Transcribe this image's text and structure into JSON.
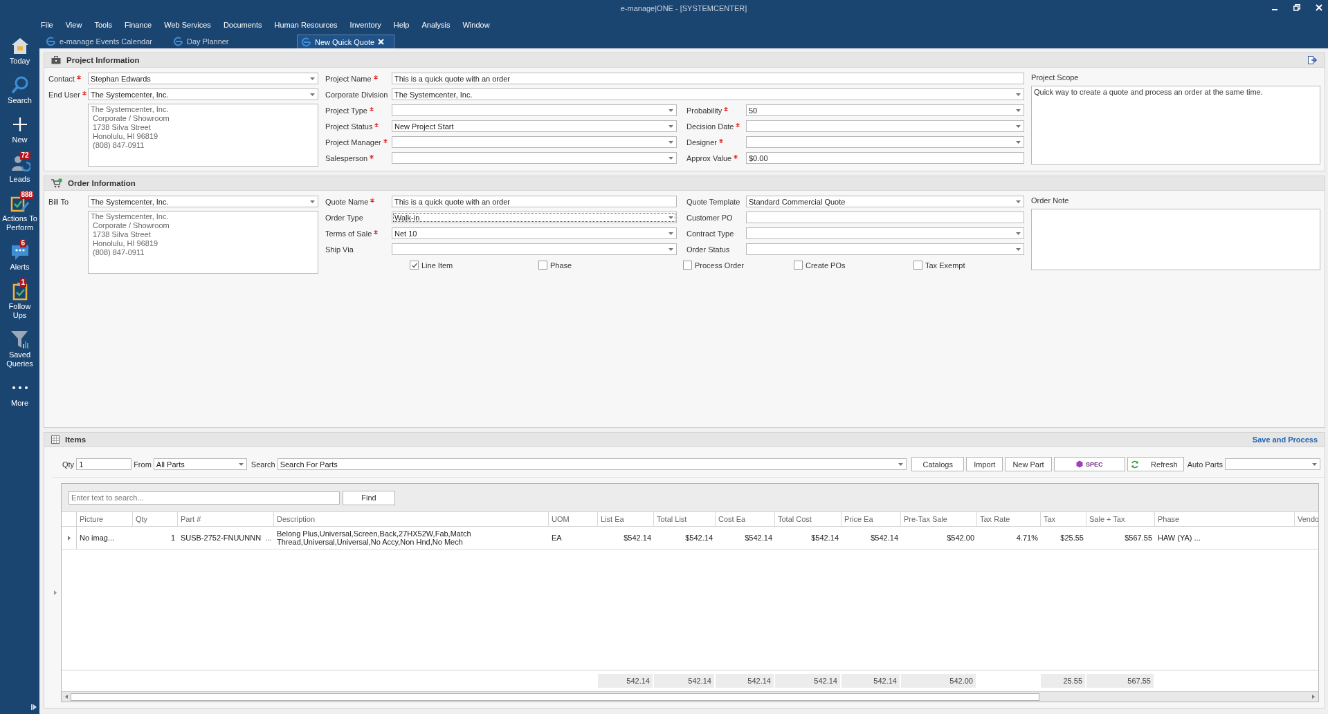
{
  "window": {
    "title": "e-manage|ONE - [SYSTEMCENTER]"
  },
  "menu": [
    "File",
    "View",
    "Tools",
    "Finance",
    "Web Services",
    "Documents",
    "Human Resources",
    "Inventory",
    "Help",
    "Analysis",
    "Window"
  ],
  "sidebar": [
    {
      "label": "Today"
    },
    {
      "label": "Search"
    },
    {
      "label": "New"
    },
    {
      "label": "Leads",
      "badge": "72"
    },
    {
      "label": "Actions To Perform",
      "badge": "888"
    },
    {
      "label": "Alerts",
      "badge": "6"
    },
    {
      "label": "Follow Ups",
      "badge": "1"
    },
    {
      "label": "Saved Queries"
    },
    {
      "label": "More"
    }
  ],
  "tabs": [
    {
      "label": "e-manage Events Calendar",
      "selected": false
    },
    {
      "label": "Day Planner",
      "selected": false
    },
    {
      "label": "New Quick Quote",
      "selected": true
    }
  ],
  "project_information": {
    "title": "Project Information",
    "contact": {
      "label": "Contact",
      "required": true,
      "value": "Stephan Edwards",
      "dropdown": true
    },
    "end_user": {
      "label": "End User",
      "required": true,
      "value": "The Systemcenter, Inc.",
      "dropdown": true
    },
    "address": [
      "The Systemcenter, Inc.",
      "Corporate / Showroom",
      "1738 Silva Street",
      "Honolulu, HI 96819",
      "(808) 847-0911"
    ],
    "wide_fields": [
      {
        "label": "Project Name",
        "required": true,
        "value": "This is a quick quote with an order",
        "dropdown": false
      },
      {
        "label": "Corporate Division",
        "required": false,
        "value": "The Systemcenter, Inc.",
        "dropdown": true
      }
    ],
    "fields": [
      {
        "label": "Project Type",
        "required": true,
        "dropdown": true
      },
      {
        "label": "Probability",
        "required": true,
        "value": "50",
        "dropdown": true
      },
      {
        "label": "Project Status",
        "required": true,
        "value": "New Project Start",
        "dropdown": true
      },
      {
        "label": "Decision Date",
        "required": true,
        "dropdown": true
      },
      {
        "label": "Project Manager",
        "required": true,
        "dropdown": true
      },
      {
        "label": "Designer",
        "required": true,
        "dropdown": true
      },
      {
        "label": "Salesperson",
        "required": true,
        "dropdown": true
      },
      {
        "label": "Approx Value",
        "required": true,
        "value": "$0.00",
        "dropdown": false
      }
    ],
    "scope": {
      "label": "Project Scope",
      "value": "Quick way to create a quote and process an order at the same time."
    }
  },
  "order_information": {
    "title": "Order Information",
    "bill_to": {
      "label": "Bill To",
      "required": false,
      "value": "The Systemcenter, Inc.",
      "dropdown": true
    },
    "address": [
      "The Systemcenter, Inc.",
      "Corporate / Showroom",
      "1738 Silva Street",
      "Honolulu, HI 96819",
      "(808) 847-0911"
    ],
    "fields": [
      {
        "label": "Quote Name",
        "required": true,
        "value": "This is a quick quote with an order",
        "dropdown": false
      },
      {
        "label": "Quote Template",
        "required": false,
        "value": "Standard Commercial Quote",
        "dropdown": true
      },
      {
        "label": "Order Type",
        "required": false,
        "value": "Walk-in",
        "dropdown": true,
        "focused": true
      },
      {
        "label": "Customer PO",
        "required": false,
        "dropdown": false
      },
      {
        "label": "Terms of Sale",
        "required": true,
        "value": "Net 10",
        "dropdown": true
      },
      {
        "label": "Contract Type",
        "required": false,
        "dropdown": true
      },
      {
        "label": "Ship Via",
        "required": false,
        "dropdown": true
      },
      {
        "label": "Order Status",
        "required": false,
        "dropdown": true
      }
    ],
    "options": [
      {
        "label": "Line Item",
        "checked": true
      },
      {
        "label": "Phase",
        "checked": false
      },
      {
        "label": "Process Order",
        "checked": false
      },
      {
        "label": "Create POs",
        "checked": false
      },
      {
        "label": "Tax Exempt",
        "checked": false
      }
    ],
    "note": {
      "label": "Order Note"
    }
  },
  "items": {
    "title": "Items",
    "save_link": "Save and Process",
    "qty": {
      "label": "Qty",
      "value": "1"
    },
    "from": {
      "label": "From",
      "value": "All Parts"
    },
    "search": {
      "label": "Search",
      "value": "Search For Parts"
    },
    "buttons": [
      {
        "label": "Catalogs",
        "kind": "plain"
      },
      {
        "label": "Import",
        "kind": "plain"
      },
      {
        "label": "New Part",
        "kind": "plain"
      },
      {
        "label": "SPEC",
        "kind": "spec"
      },
      {
        "label": "Refresh",
        "kind": "refresh"
      }
    ],
    "auto_parts": {
      "label": "Auto Parts"
    },
    "find": {
      "placeholder": "Enter text to search...",
      "button": "Find"
    },
    "columns": [
      {
        "label": "Picture"
      },
      {
        "label": "Qty"
      },
      {
        "label": "Part #"
      },
      {
        "label": "Description"
      },
      {
        "label": "UOM"
      },
      {
        "label": "List Ea"
      },
      {
        "label": "Total List"
      },
      {
        "label": "Cost Ea"
      },
      {
        "label": "Total Cost"
      },
      {
        "label": "Price Ea"
      },
      {
        "label": "Pre-Tax Sale"
      },
      {
        "label": "Tax Rate"
      },
      {
        "label": "Tax"
      },
      {
        "label": "Sale + Tax"
      },
      {
        "label": "Phase"
      },
      {
        "label": "Vendo"
      }
    ],
    "totals": {
      "cells": [
        null,
        null,
        null,
        null,
        null,
        "542.14",
        "542.14",
        "542.14",
        "542.14",
        "542.14",
        "542.00",
        null,
        "25.55",
        "567.55"
      ]
    },
    "rows": [
      {
        "part_button": "...",
        "cells": [
          "No imag...",
          "1",
          "SUSB-2752-FNUUNNN",
          "Belong Plus,Universal,Screen,Back,27HX52W,Fab,Match Thread,Universal,Universal,No Accy,Non Hnd,No Mech",
          "EA",
          "$542.14",
          "$542.14",
          "$542.14",
          "$542.14",
          "$542.14",
          "$542.00",
          "4.71%",
          "$25.55",
          "$567.55",
          "HAW (YA) ..."
        ]
      }
    ]
  }
}
